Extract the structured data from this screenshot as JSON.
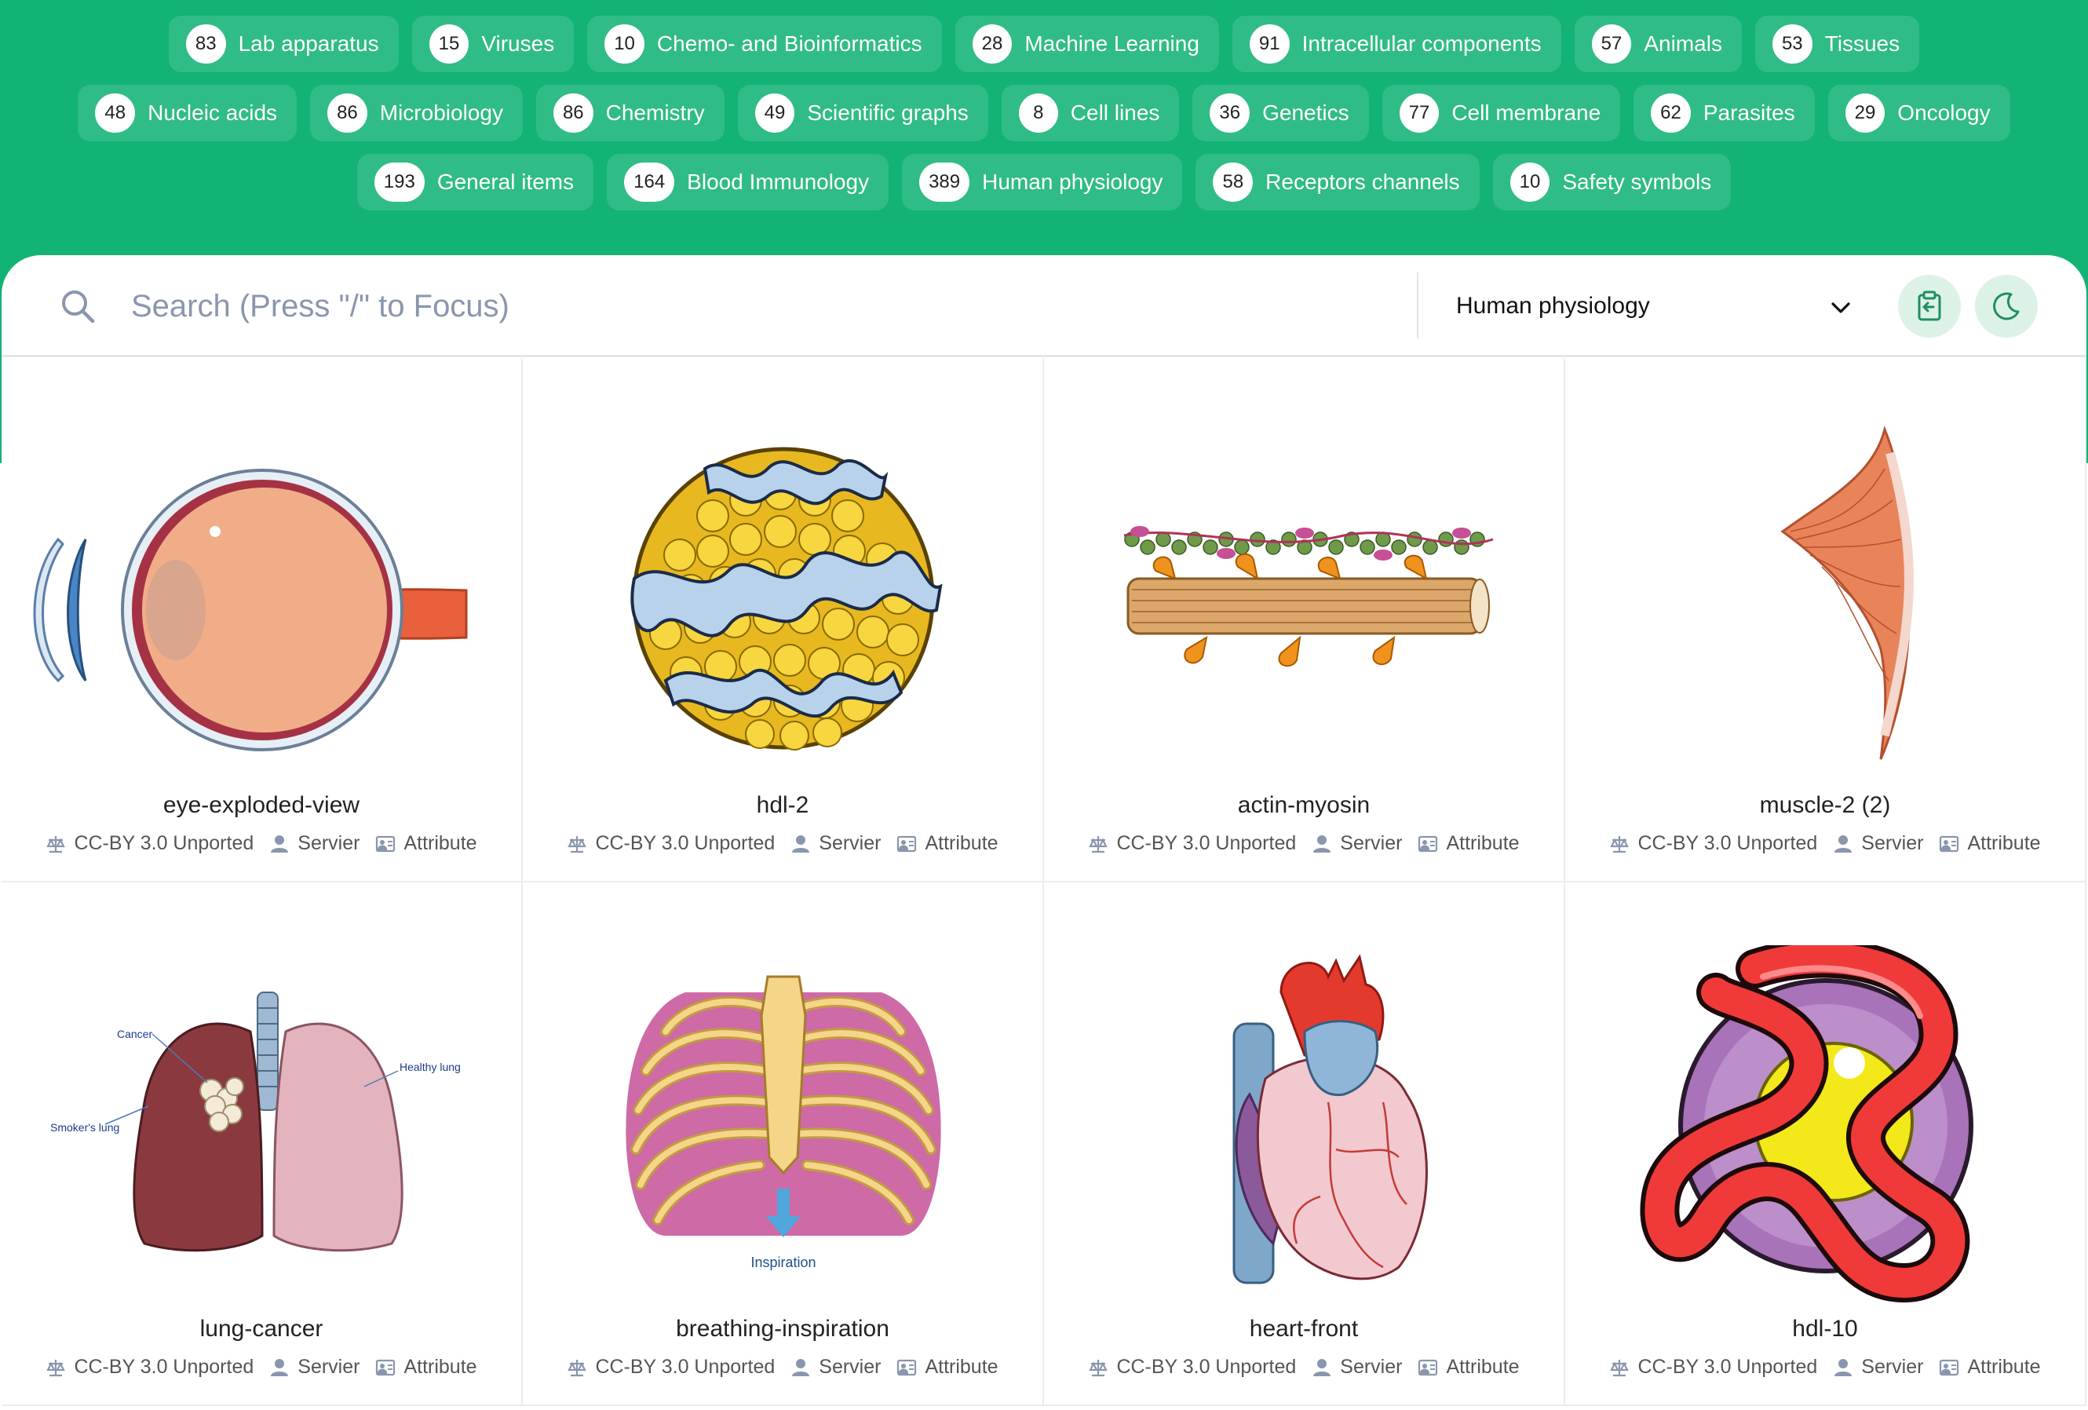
{
  "categories": [
    [
      {
        "count": "83",
        "label": "Lab apparatus"
      },
      {
        "count": "15",
        "label": "Viruses"
      },
      {
        "count": "10",
        "label": "Chemo- and Bioinformatics"
      },
      {
        "count": "28",
        "label": "Machine Learning"
      },
      {
        "count": "91",
        "label": "Intracellular components"
      },
      {
        "count": "57",
        "label": "Animals"
      },
      {
        "count": "53",
        "label": "Tissues"
      }
    ],
    [
      {
        "count": "48",
        "label": "Nucleic acids"
      },
      {
        "count": "86",
        "label": "Microbiology"
      },
      {
        "count": "86",
        "label": "Chemistry"
      },
      {
        "count": "49",
        "label": "Scientific graphs"
      },
      {
        "count": "8",
        "label": "Cell lines"
      },
      {
        "count": "36",
        "label": "Genetics"
      },
      {
        "count": "77",
        "label": "Cell membrane"
      },
      {
        "count": "62",
        "label": "Parasites"
      },
      {
        "count": "29",
        "label": "Oncology"
      }
    ],
    [
      {
        "count": "193",
        "label": "General items"
      },
      {
        "count": "164",
        "label": "Blood Immunology"
      },
      {
        "count": "389",
        "label": "Human physiology"
      },
      {
        "count": "58",
        "label": "Receptors channels"
      },
      {
        "count": "10",
        "label": "Safety symbols"
      }
    ]
  ],
  "search": {
    "placeholder": "Search (Press \"/\" to Focus)",
    "selected_category": "Human physiology"
  },
  "cards": [
    {
      "title": "eye-exploded-view",
      "license": "CC-BY 3.0 Unported",
      "author": "Servier",
      "action": "Attribute",
      "art": "eye-exploded"
    },
    {
      "title": "hdl-2",
      "license": "CC-BY 3.0 Unported",
      "author": "Servier",
      "action": "Attribute",
      "art": "hdl-yellow"
    },
    {
      "title": "actin-myosin",
      "license": "CC-BY 3.0 Unported",
      "author": "Servier",
      "action": "Attribute",
      "art": "actin-myosin"
    },
    {
      "title": "muscle-2 (2)",
      "license": "CC-BY 3.0 Unported",
      "author": "Servier",
      "action": "Attribute",
      "art": "muscle"
    },
    {
      "title": "lung-cancer",
      "license": "CC-BY 3.0 Unported",
      "author": "Servier",
      "action": "Attribute",
      "art": "lungs",
      "labels": {
        "cancer": "Cancer",
        "healthy": "Healthy lung",
        "smoker": "Smoker's lung"
      }
    },
    {
      "title": "breathing-inspiration",
      "license": "CC-BY 3.0 Unported",
      "author": "Servier",
      "action": "Attribute",
      "art": "ribcage",
      "labels": {
        "caption": "Inspiration"
      }
    },
    {
      "title": "heart-front",
      "license": "CC-BY 3.0 Unported",
      "author": "Servier",
      "action": "Attribute",
      "art": "heart"
    },
    {
      "title": "hdl-10",
      "license": "CC-BY 3.0 Unported",
      "author": "Servier",
      "action": "Attribute",
      "art": "hdl-purple"
    }
  ],
  "colors": {
    "brand_green": "#12b375",
    "chip_bg": "rgba(255,255,255,0.13)",
    "placeholder": "#8a96ad",
    "icon_green": "#1f8f5f"
  }
}
